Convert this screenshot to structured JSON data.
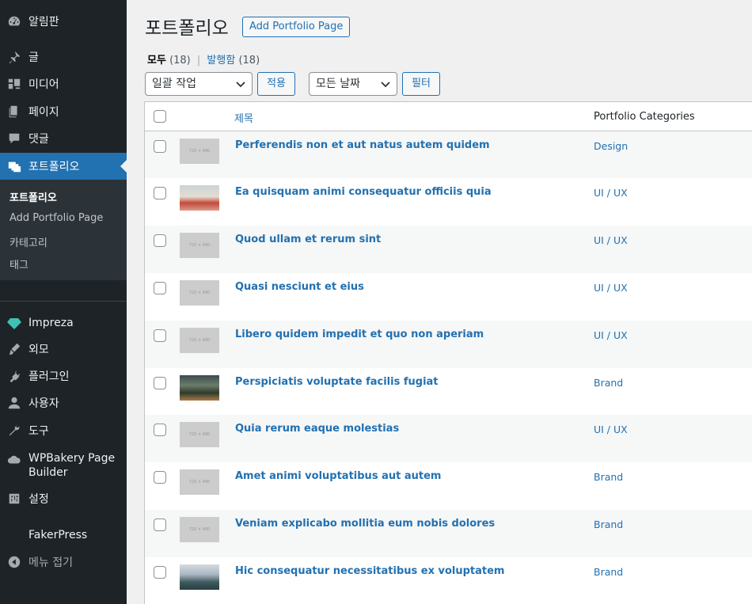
{
  "sidebar": {
    "dashboard": "알림판",
    "posts": "글",
    "media": "미디어",
    "pages": "페이지",
    "comments": "댓글",
    "portfolio": "포트폴리오",
    "submenu": [
      "포트폴리오",
      "Add Portfolio Page",
      "카테고리",
      "태그"
    ],
    "impreza": "Impreza",
    "appearance": "외모",
    "plugins": "플러그인",
    "users": "사용자",
    "tools": "도구",
    "wpbakery_line1": "WPBakery Page",
    "wpbakery_line2": "Builder",
    "settings": "설정",
    "fakerpress": "FakerPress",
    "collapse": "메뉴 접기"
  },
  "header": {
    "title": "포트폴리오",
    "add_button": "Add Portfolio Page"
  },
  "views": {
    "all_label": "모두",
    "all_count": "(18)",
    "separator": "|",
    "published_label": "발행함",
    "published_count": "(18)"
  },
  "filters": {
    "bulk_action": "일괄 작업",
    "apply": "적용",
    "all_dates": "모든 날짜",
    "filter": "필터"
  },
  "table": {
    "col_title": "제목",
    "col_categories": "Portfolio Categories",
    "thumb_placeholder": "720 × 480",
    "rows": [
      {
        "title": "Perferendis non et aut natus autem quidem",
        "category": "Design",
        "thumb": "placeholder"
      },
      {
        "title": "Ea quisquam animi consequatur officiis quia",
        "category": "UI / UX",
        "thumb": "photo-beach"
      },
      {
        "title": "Quod ullam et rerum sint",
        "category": "UI / UX",
        "thumb": "placeholder"
      },
      {
        "title": "Quasi nesciunt et eius",
        "category": "UI / UX",
        "thumb": "placeholder"
      },
      {
        "title": "Libero quidem impedit et quo non aperiam",
        "category": "UI / UX",
        "thumb": "placeholder"
      },
      {
        "title": "Perspiciatis voluptate facilis fugiat",
        "category": "Brand",
        "thumb": "photo-forest"
      },
      {
        "title": "Quia rerum eaque molestias",
        "category": "UI / UX",
        "thumb": "placeholder"
      },
      {
        "title": "Amet animi voluptatibus aut autem",
        "category": "Brand",
        "thumb": "placeholder"
      },
      {
        "title": "Veniam explicabo mollitia eum nobis dolores",
        "category": "Brand",
        "thumb": "placeholder"
      },
      {
        "title": "Hic consequatur necessitatibus ex voluptatem",
        "category": "Brand",
        "thumb": "photo-mountain"
      }
    ]
  },
  "colors": {
    "sidebar_bg": "#1d2327",
    "accent": "#2271b1",
    "impreza_gem": "#3ec1b3"
  }
}
